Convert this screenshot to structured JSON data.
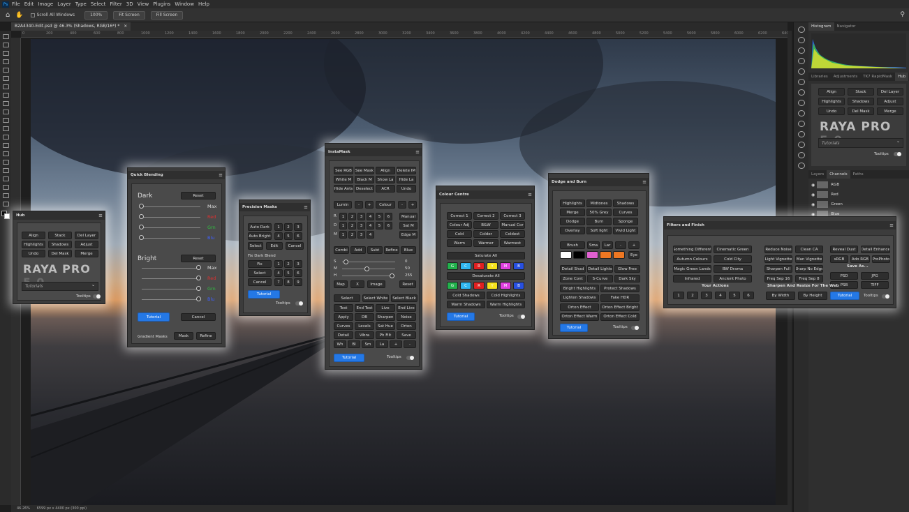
{
  "app": {
    "menu": [
      "File",
      "Edit",
      "Image",
      "Layer",
      "Type",
      "Select",
      "Filter",
      "3D",
      "View",
      "Plugins",
      "Window",
      "Help"
    ],
    "options": {
      "scroll_all": "Scroll All Windows",
      "zoom": "100%",
      "fit": "Fit Screen",
      "fill": "Fill Screen"
    },
    "tab_title": "B2A4340-Edit.psd @ 46.3% (Shadows, RGB/16*) *",
    "ruler": [
      "0",
      "200",
      "400",
      "600",
      "800",
      "1000",
      "1200",
      "1400",
      "1600",
      "1800",
      "2000",
      "2200",
      "2400",
      "2600",
      "2800",
      "3000",
      "3200",
      "3400",
      "3600",
      "3800",
      "4000",
      "4200",
      "4400",
      "4600",
      "4800",
      "5000",
      "5200",
      "5400",
      "5600",
      "5800",
      "6000",
      "6200",
      "6400"
    ],
    "status": {
      "zoom": "46.26%",
      "dims": "6599 px x 4400 px (300 ppi)"
    }
  },
  "right": {
    "top_tabs": [
      "Histogram",
      "Navigator"
    ],
    "mid_tabs": [
      "Libraries",
      "Adjustments",
      "TK7 RapidMask",
      "Hub"
    ],
    "hub": {
      "buttons": [
        "Align",
        "Stack",
        "Del Layer",
        "Highlights",
        "Shadows",
        "Adjust",
        "Undo",
        "Del Mask",
        "Merge"
      ],
      "logo": "RAYA PRO",
      "ver": "5.0",
      "tutorials": "Tutorials",
      "tooltips": "Tooltips"
    },
    "layer_tabs": [
      "Layers",
      "Channels",
      "Paths"
    ],
    "channels": [
      "RGB",
      "Red",
      "Green",
      "Blue"
    ]
  },
  "hub": {
    "title": "Hub",
    "buttons": [
      "Align",
      "Stack",
      "Del Layer",
      "Highlights",
      "Shadows",
      "Adjust",
      "Undo",
      "Del Mask",
      "Merge"
    ],
    "logo": "RAYA PRO",
    "ver": "5.0",
    "tutorials": "Tutorials",
    "tooltips": "Tooltips"
  },
  "qb": {
    "title": "Quick Blending",
    "dark": "Dark",
    "bright": "Bright",
    "reset": "Reset",
    "rows": [
      "Max",
      "Red",
      "Grn",
      "Blu"
    ],
    "tutorial": "Tutorial",
    "cancel": "Cancel",
    "gradient": "Gradient Masks",
    "mask": "Mask",
    "refine": "Refine"
  },
  "pm": {
    "title": "Precision Masks",
    "auto_dark": "Auto Dark",
    "auto_bright": "Auto Bright",
    "select": "Select",
    "edit": "Edit",
    "cancel": "Cancel",
    "fix_label": "Fix Dark Blend",
    "fix": "Fix",
    "cancel2": "Cancel",
    "nums1": [
      "1",
      "2",
      "3",
      "4",
      "5",
      "6"
    ],
    "nums2": [
      "1",
      "2",
      "3",
      "4",
      "5",
      "6",
      "7",
      "8",
      "9"
    ],
    "tutorial": "Tutorial",
    "tooltips": "Tooltips"
  },
  "im": {
    "title": "InstaMask",
    "grid1": [
      "See RGB",
      "See Mask",
      "Align",
      "Delete IM",
      "White M",
      "Black M",
      "Show La",
      "Hide La",
      "Hide Ants",
      "Deselect",
      "ACR",
      "Undo"
    ],
    "lumin": "Lumin",
    "colour": "Colour",
    "minus": "-",
    "plus": "+",
    "rows": [
      "R",
      "D",
      "M"
    ],
    "nums": [
      "1",
      "2",
      "3",
      "4",
      "5",
      "6"
    ],
    "manual": "Manual",
    "satm": "Sat M",
    "edgem": "Edge M",
    "grid2": [
      "Combi",
      "Add",
      "Subt",
      "Refine",
      "Blue"
    ],
    "sl": [
      "S",
      "M",
      "H"
    ],
    "slv": [
      "0",
      "50",
      "255"
    ],
    "map": "Map",
    "x": "X",
    "image": "Image",
    "reset": "Reset",
    "grid3": [
      "Select",
      "Select White",
      "Select Black",
      "Test",
      "End Test",
      "Live",
      "End Live",
      "Apply",
      "DB",
      "Sharpen",
      "Noise",
      "Curves",
      "Levels",
      "Sat Hue",
      "Orton",
      "Detail",
      "Vibra",
      "Ph Filt",
      "Save",
      "Wh",
      "Bl",
      "Sm",
      "La",
      "+",
      "-"
    ],
    "tutorial": "Tutorial",
    "tooltips": "Tooltips"
  },
  "cc": {
    "title": "Colour Centre",
    "grid": [
      "Correct 1",
      "Correct 2",
      "Correct 3",
      "Colour Adj",
      "B&W",
      "Manual Cor",
      "Cold",
      "Colder",
      "Coldest",
      "Warm",
      "Warmer",
      "Warmest"
    ],
    "sat": "Saturate All",
    "desat": "Desaturate All",
    "swatches": [
      "G",
      "C",
      "R",
      "Y",
      "M",
      "B"
    ],
    "sw_colors": [
      "#22b14c",
      "#2fb6f0",
      "#e02020",
      "#f5e21c",
      "#e040e0",
      "#2850e0"
    ],
    "grid2": [
      "Cold Shadows",
      "Cold Highlights",
      "Warm Shadows",
      "Warm Highlights"
    ],
    "tutorial": "Tutorial",
    "tooltips": "Tooltips"
  },
  "db": {
    "title": "Dodge and Burn",
    "grid": [
      "Highlights",
      "Midtones",
      "Shadows",
      "Merge",
      "50% Grey",
      "Curves",
      "Dodge",
      "Burn",
      "Sponge",
      "Overlay",
      "Soft light",
      "Vivid Light"
    ],
    "brush": "Brush",
    "sma": "Sma",
    "lar": "Lar",
    "minus": "-",
    "plus": "+",
    "eye": "Eye",
    "sw_colors": [
      "#ffffff",
      "#000000",
      "#e060d0",
      "#ee7722",
      "#ee7722"
    ],
    "grid2": [
      "Detail Shad",
      "Detail Lights",
      "Glow Free",
      "Zone Cont",
      "S-Curve",
      "Dark Sky",
      "Bright Highlights",
      "Protect Shadows",
      "Lighten Shadows",
      "Fake HDR",
      "Orton Effect",
      "Orton Effect Bright",
      "Orton Effect Warm",
      "Orton Effect Cold"
    ],
    "tutorial": "Tutorial",
    "tooltips": "Tooltips"
  },
  "ff": {
    "title": "Filters and Finish",
    "col1": [
      "Something Different",
      "Cinematic Green",
      "Autumn Colours",
      "Cold City",
      "Magic Green Lands",
      "BW Drama",
      "Infrared",
      "Ancient Photo"
    ],
    "actions": "Your Actions",
    "nums": [
      "1",
      "2",
      "3",
      "4",
      "5",
      "6"
    ],
    "col2": [
      "Reduce Noise",
      "Clean CA",
      "Light Vignette",
      "Man Vignette",
      "Sharpen Full",
      "Sharp No Edge",
      "Freq Sep 16",
      "Freq Sep 8"
    ],
    "col3": [
      "Reveal Dust",
      "Detail Enhance",
      "sRGB",
      "Ado RGB",
      "ProPhoto"
    ],
    "save_as": "Save As...",
    "formats": [
      "PSD",
      "JPG",
      "PSB",
      "TIFF"
    ],
    "sharpen": "Sharpen And Resize For The Web",
    "bywidth": "By Width",
    "byheight": "By Height",
    "tutorial": "Tutorial",
    "tooltips": "Tooltips"
  }
}
